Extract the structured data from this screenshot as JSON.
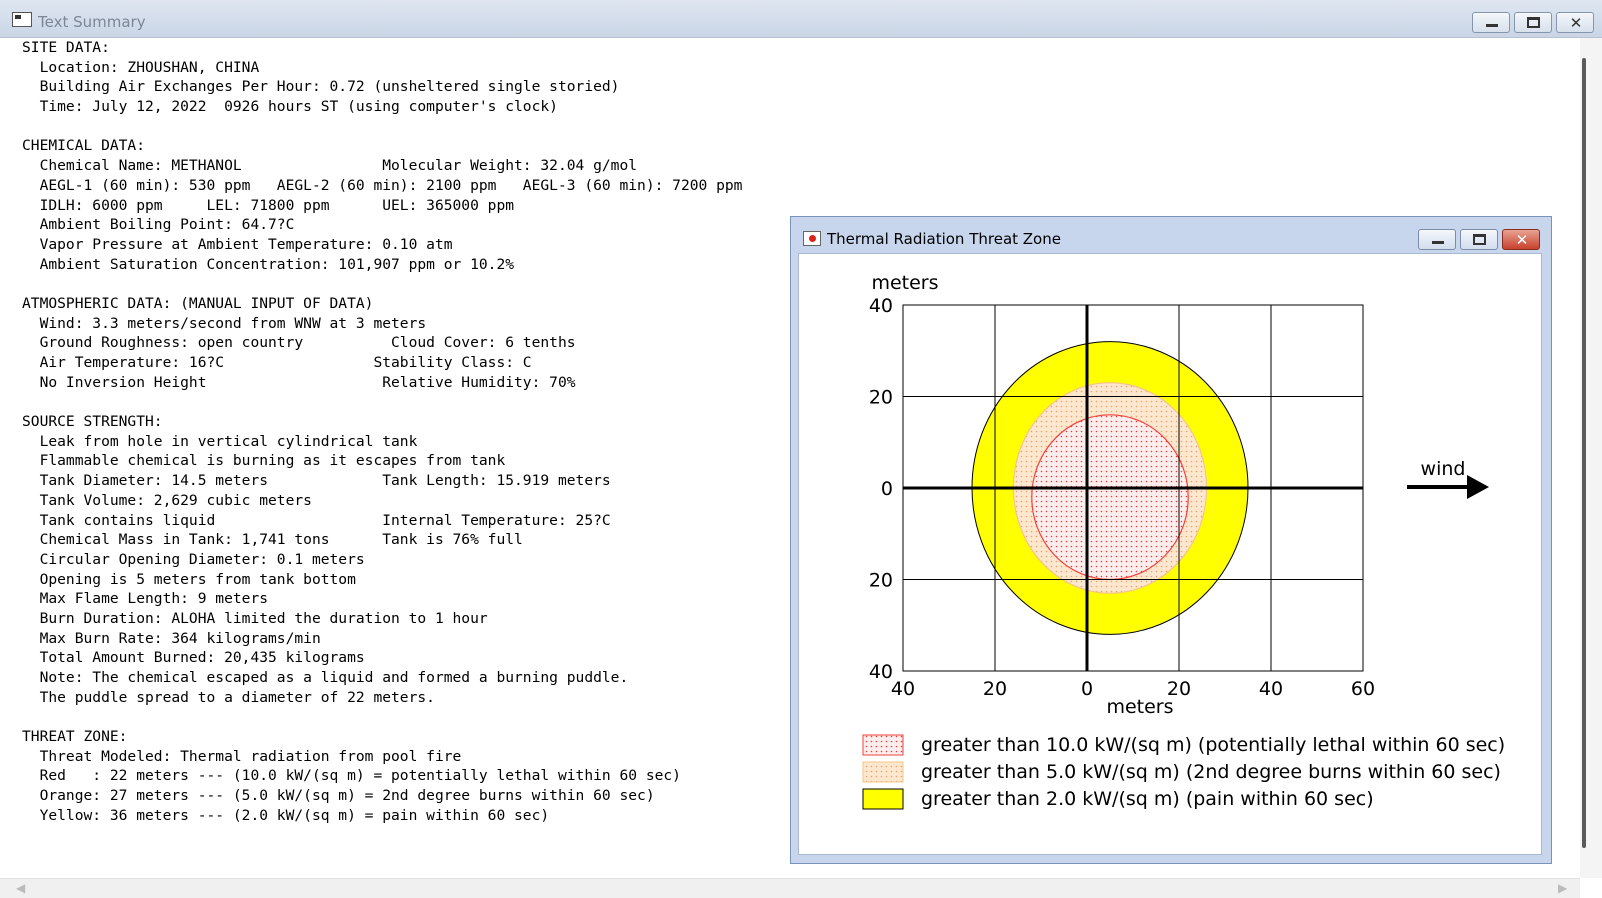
{
  "window": {
    "title": "Text Summary"
  },
  "report": {
    "lines": [
      "SITE DATA:",
      "  Location: ZHOUSHAN, CHINA",
      "  Building Air Exchanges Per Hour: 0.72 (unsheltered single storied)",
      "  Time: July 12, 2022  0926 hours ST (using computer's clock)",
      "",
      "CHEMICAL DATA:",
      "  Chemical Name: METHANOL                Molecular Weight: 32.04 g/mol",
      "  AEGL-1 (60 min): 530 ppm   AEGL-2 (60 min): 2100 ppm   AEGL-3 (60 min): 7200 ppm",
      "  IDLH: 6000 ppm     LEL: 71800 ppm      UEL: 365000 ppm",
      "  Ambient Boiling Point: 64.7?C",
      "  Vapor Pressure at Ambient Temperature: 0.10 atm",
      "  Ambient Saturation Concentration: 101,907 ppm or 10.2%",
      "",
      "ATMOSPHERIC DATA: (MANUAL INPUT OF DATA)",
      "  Wind: 3.3 meters/second from WNW at 3 meters",
      "  Ground Roughness: open country          Cloud Cover: 6 tenths",
      "  Air Temperature: 16?C                 Stability Class: C",
      "  No Inversion Height                    Relative Humidity: 70%",
      "",
      "SOURCE STRENGTH:",
      "  Leak from hole in vertical cylindrical tank",
      "  Flammable chemical is burning as it escapes from tank",
      "  Tank Diameter: 14.5 meters             Tank Length: 15.919 meters",
      "  Tank Volume: 2,629 cubic meters",
      "  Tank contains liquid                   Internal Temperature: 25?C",
      "  Chemical Mass in Tank: 1,741 tons      Tank is 76% full",
      "  Circular Opening Diameter: 0.1 meters",
      "  Opening is 5 meters from tank bottom",
      "  Max Flame Length: 9 meters",
      "  Burn Duration: ALOHA limited the duration to 1 hour",
      "  Max Burn Rate: 364 kilograms/min",
      "  Total Amount Burned: 20,435 kilograms",
      "  Note: The chemical escaped as a liquid and formed a burning puddle.",
      "  The puddle spread to a diameter of 22 meters.",
      "",
      "THREAT ZONE:",
      "  Threat Modeled: Thermal radiation from pool fire",
      "  Red   : 22 meters --- (10.0 kW/(sq m) = potentially lethal within 60 sec)",
      "  Orange: 27 meters --- (5.0 kW/(sq m) = 2nd degree burns within 60 sec)",
      "  Yellow: 36 meters --- (2.0 kW/(sq m) = pain within 60 sec)"
    ]
  },
  "child_window": {
    "title": "Thermal Radiation Threat Zone"
  },
  "chart_data": {
    "type": "threat-zone-plot",
    "ylabel": "meters",
    "xlabel": "meters",
    "x_ticks": [
      "40",
      "20",
      "0",
      "20",
      "40",
      "60"
    ],
    "y_ticks": [
      "40",
      "20",
      "0",
      "20",
      "40"
    ],
    "xlim": [
      -40,
      60
    ],
    "ylim": [
      -40,
      40
    ],
    "grid": true,
    "wind_label": "wind",
    "zones": [
      {
        "name": "greater than 10.0 kW/(sq m) (potentially lethal within 60 sec)",
        "color": "#f2413b",
        "fill": "#fbe3e3",
        "center_x": 5,
        "center_y": -2,
        "rx": 17,
        "ry": 18
      },
      {
        "name": "greater than 5.0 kW/(sq m) (2nd degree burns within 60 sec)",
        "color": "#f7c48a",
        "fill": "#fbe1c8",
        "center_x": 5,
        "center_y": 0,
        "rx": 21,
        "ry": 23
      },
      {
        "name": "greater than 2.0 kW/(sq m) (pain within 60 sec)",
        "color": "#ffff00",
        "fill": "#ffff00",
        "center_x": 5,
        "center_y": 0,
        "rx": 30,
        "ry": 32
      }
    ]
  },
  "legend": [
    {
      "label": "greater than 10.0 kW/(sq m) (potentially lethal within 60 sec)",
      "fill": "#fbe3e3",
      "stroke": "#f2413b"
    },
    {
      "label": "greater than 5.0 kW/(sq m) (2nd degree burns within 60 sec)",
      "fill": "#fbe1c8",
      "stroke": "#f7c48a"
    },
    {
      "label": "greater than 2.0 kW/(sq m) (pain within 60 sec)",
      "fill": "#ffff00",
      "stroke": "#000000"
    }
  ]
}
